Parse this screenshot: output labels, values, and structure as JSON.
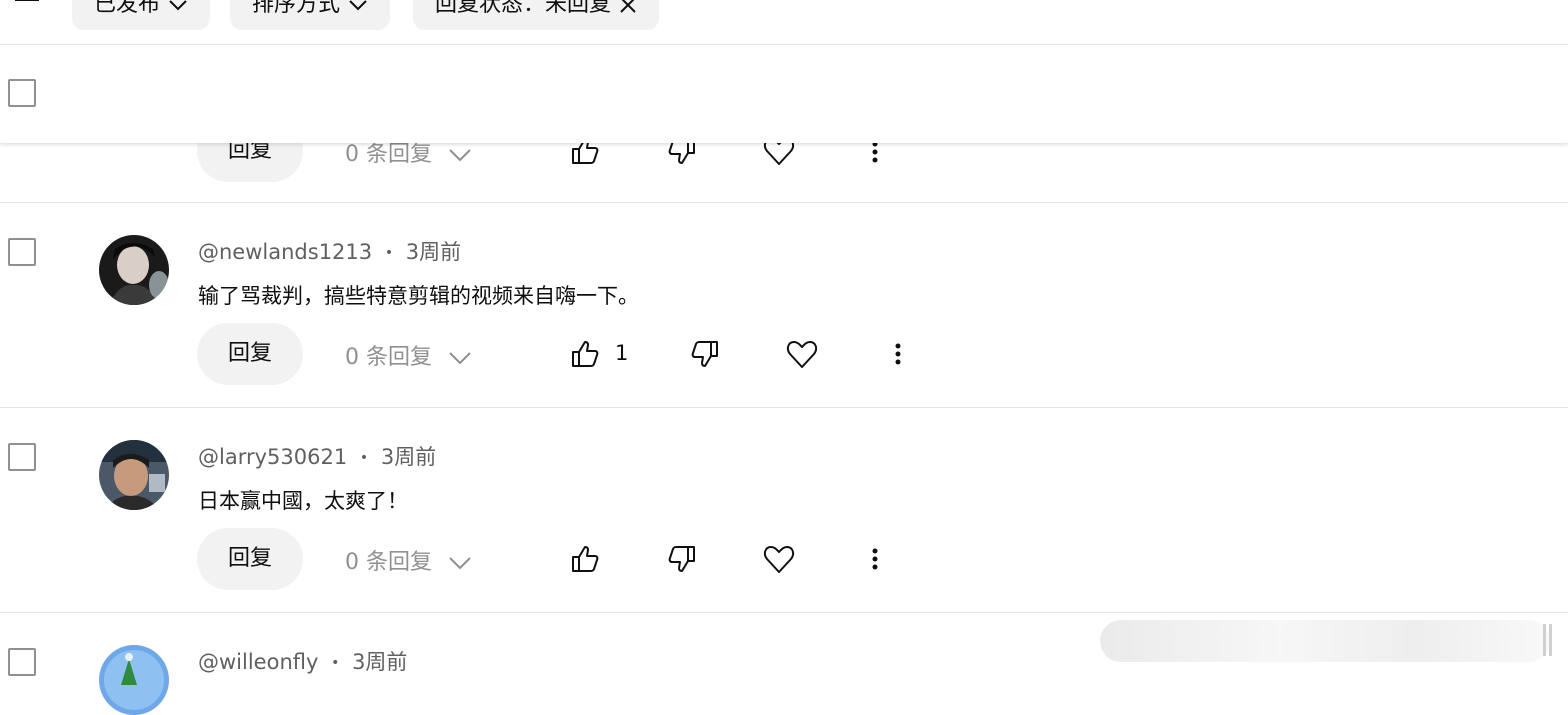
{
  "filters": {
    "chips": [
      {
        "label": "已发布",
        "icon": "chevron-down-icon"
      },
      {
        "label": "排序方式",
        "icon": "chevron-down-icon"
      },
      {
        "label": "回复状态：未回复",
        "icon": "close-icon"
      }
    ]
  },
  "comments": [
    {
      "author": "",
      "time": "",
      "text": "",
      "reply_label": "回复",
      "reply_count": "0 条回复",
      "likes": ""
    },
    {
      "author": "@newlands1213",
      "time": "3周前",
      "text": "输了骂裁判，搞些特意剪辑的视频来自嗨一下。",
      "reply_label": "回复",
      "reply_count": "0 条回复",
      "likes": "1"
    },
    {
      "author": "@larry530621",
      "time": "3周前",
      "text": "日本赢中國，太爽了！",
      "reply_label": "回复",
      "reply_count": "0 条回复",
      "likes": ""
    },
    {
      "author": "@willeonfly",
      "time": "3周前",
      "text": "",
      "reply_label": "",
      "reply_count": "",
      "likes": ""
    }
  ],
  "separator": "•",
  "colors": {
    "chip_bg": "#f2f2f2",
    "muted_text": "#606060",
    "reply_count_text": "#909090",
    "divider": "#e5e5e5"
  }
}
